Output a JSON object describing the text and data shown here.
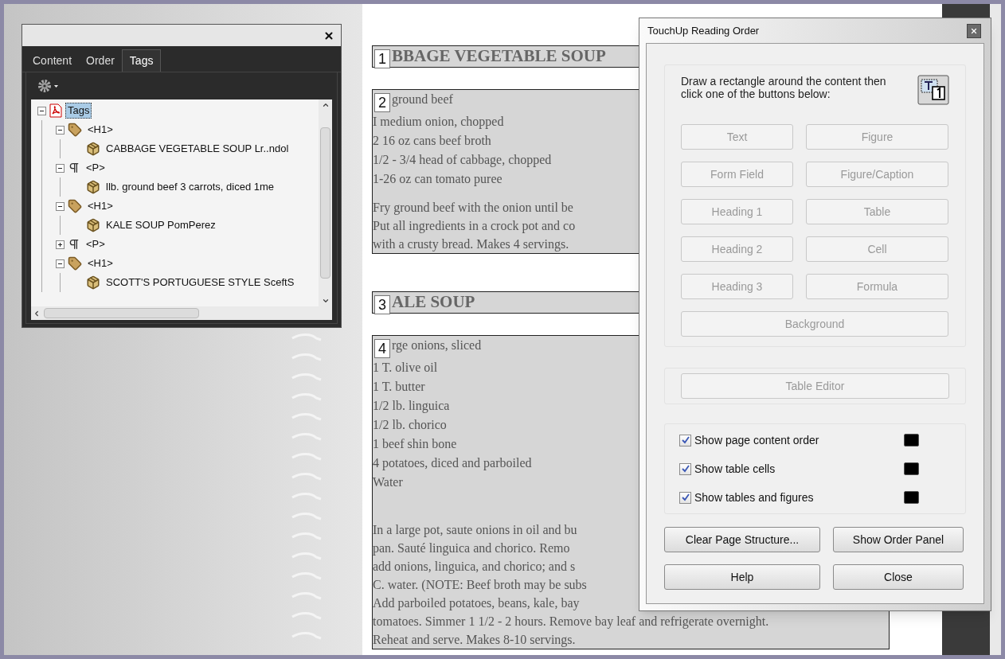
{
  "tags_panel": {
    "tabs": [
      {
        "label": "Content",
        "selected": false
      },
      {
        "label": "Order",
        "selected": false
      },
      {
        "label": "Tags",
        "selected": true
      }
    ],
    "tree": [
      {
        "label": "Tags",
        "kind": "root",
        "selected": true,
        "expanded": true,
        "children": [
          {
            "label": "<H1>",
            "kind": "tag",
            "selected": false,
            "expanded": true,
            "children": [
              {
                "label": "CABBAGE VEGETABLE SOUP Lr..ndol",
                "kind": "content",
                "selected": false
              }
            ]
          },
          {
            "label": "<P>",
            "kind": "paragraph",
            "selected": false,
            "expanded": true,
            "children": [
              {
                "label": "llb. ground beef 3 carrots, diced 1me",
                "kind": "content",
                "selected": false
              }
            ]
          },
          {
            "label": "<H1>",
            "kind": "tag",
            "selected": false,
            "expanded": true,
            "children": [
              {
                "label": "KALE SOUP PomPerez",
                "kind": "content",
                "selected": false
              }
            ]
          },
          {
            "label": "<P>",
            "kind": "paragraph",
            "selected": false,
            "expanded": false
          },
          {
            "label": "<H1>",
            "kind": "tag",
            "selected": false,
            "expanded": true,
            "children": [
              {
                "label": "SCOTT'S PORTUGUESE STYLE SceftS",
                "kind": "content",
                "selected": false
              }
            ]
          }
        ]
      }
    ]
  },
  "document": {
    "blocks": [
      {
        "number": "1",
        "kind": "heading",
        "paragraphs": [
          [
            "BBAGE VEGETABLE SOUP"
          ]
        ]
      },
      {
        "number": "2",
        "kind": "body",
        "paragraphs": [
          [
            "ground beef",
            "I medium onion, chopped",
            "2 16 oz cans beef broth",
            "1/2 - 3/4 head of cabbage, chopped",
            "1-26 oz can tomato puree"
          ],
          [
            "Fry ground beef with the onion until be",
            "Put all ingredients in a crock pot and co",
            "with a crusty bread. Makes 4 servings."
          ]
        ]
      },
      {
        "number": "3",
        "kind": "heading",
        "paragraphs": [
          [
            "ALE SOUP"
          ]
        ]
      },
      {
        "number": "4",
        "kind": "body",
        "paragraphs": [
          [
            "rge onions, sliced",
            "1 T. olive oil",
            "1 T. butter",
            "1/2 lb. linguica",
            "1/2 lb. chorico",
            "1 beef shin bone",
            "4 potatoes, diced and parboiled",
            "Water"
          ],
          [
            "In a large pot, saute onions in oil and bu",
            "pan. Sauté linguica and chorico. Remo",
            "add onions, linguica, and chorico; and s",
            "C. water. (NOTE: Beef broth may be subs",
            "Add parboiled potatoes, beans, kale, bay",
            "tomatoes. Simmer 1 1/2 - 2 hours. Remove bay leaf and refrigerate overnight.",
            "Reheat and serve. Makes 8-10 servings."
          ]
        ]
      }
    ]
  },
  "dialog": {
    "title": "TouchUp Reading Order",
    "instruction": "Draw a rectangle around the content then click one of the buttons below:",
    "tag_buttons": [
      {
        "label": "Text",
        "disabled": true
      },
      {
        "label": "Figure",
        "disabled": true
      },
      {
        "label": "Form Field",
        "disabled": true
      },
      {
        "label": "Figure/Caption",
        "disabled": true
      },
      {
        "label": "Heading 1",
        "disabled": true
      },
      {
        "label": "Table",
        "disabled": true
      },
      {
        "label": "Heading 2",
        "disabled": true
      },
      {
        "label": "Cell",
        "disabled": true
      },
      {
        "label": "Heading 3",
        "disabled": true
      },
      {
        "label": "Formula",
        "disabled": true
      },
      {
        "label": "Background",
        "disabled": true
      }
    ],
    "table_editor": {
      "label": "Table Editor",
      "disabled": true
    },
    "options": [
      {
        "label": "Show page content order",
        "checked": true,
        "color": "#000000"
      },
      {
        "label": "Show table cells",
        "checked": true,
        "color": "#000000"
      },
      {
        "label": "Show tables and figures",
        "checked": true,
        "color": "#000000"
      }
    ],
    "actions": [
      {
        "label": "Clear Page Structure...",
        "disabled": false
      },
      {
        "label": "Show Order Panel",
        "disabled": false
      },
      {
        "label": "Help",
        "disabled": false
      },
      {
        "label": "Close",
        "disabled": false
      }
    ]
  }
}
